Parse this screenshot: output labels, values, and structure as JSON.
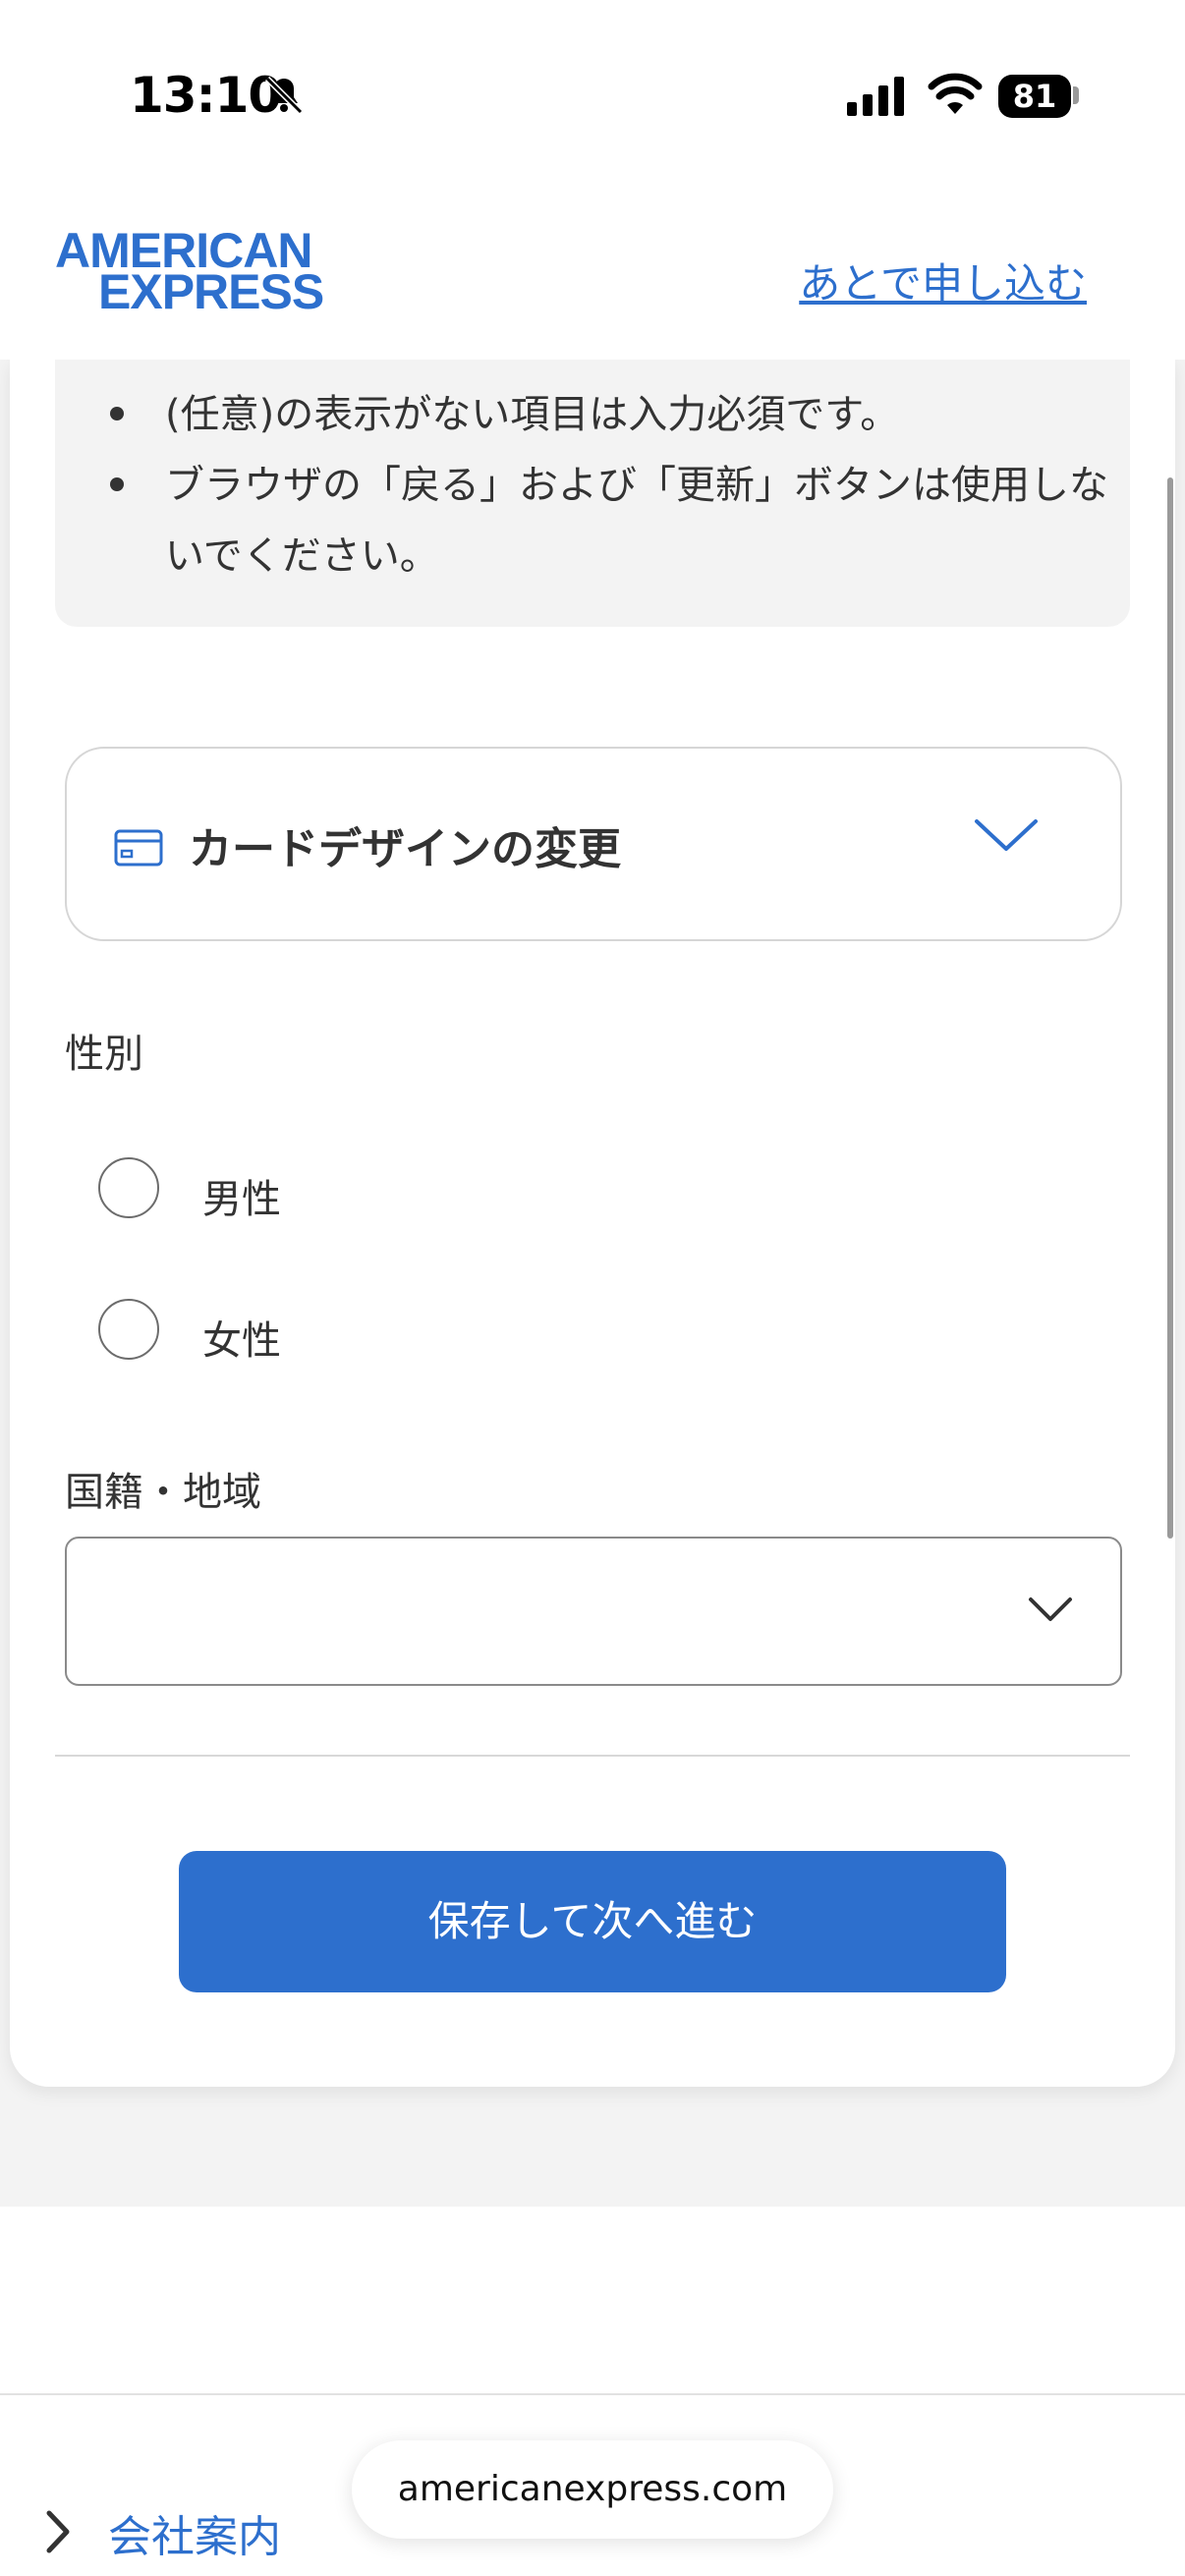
{
  "status_bar": {
    "time": "13:10",
    "battery": "81"
  },
  "header": {
    "logo_line1": "AMERICAN",
    "logo_line2": "EXPRESS",
    "apply_later": "あとで申し込む"
  },
  "notice": {
    "items": [
      "(任意)の表示がない項目は入力必須です。",
      "ブラウザの「戻る」および「更新」ボタンは使用しないでください。"
    ]
  },
  "card_design": {
    "title": "カードデザインの変更"
  },
  "gender": {
    "label": "性別",
    "options": [
      "男性",
      "女性"
    ]
  },
  "nationality": {
    "label": "国籍・地域",
    "value": ""
  },
  "save_button": "保存して次へ進む",
  "footer": {
    "company_link": "会社案内"
  },
  "browser": {
    "url": "americanexpress.com"
  },
  "colors": {
    "brand": "#2d6fcd",
    "text": "#333333",
    "background": "#f3f3f3"
  }
}
